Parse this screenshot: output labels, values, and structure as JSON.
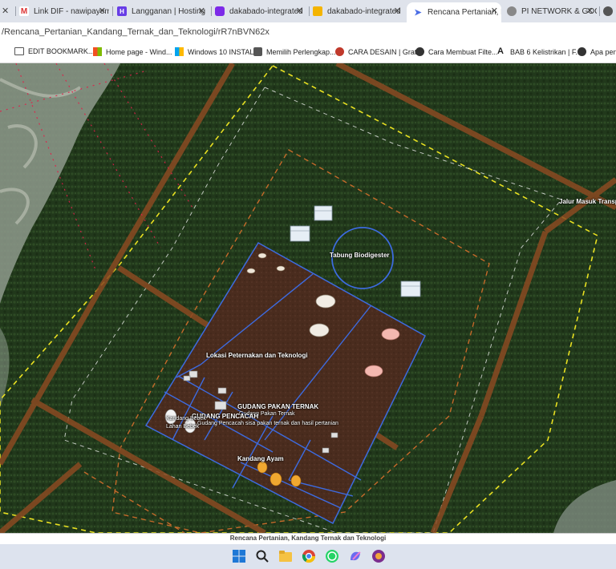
{
  "tabs": [
    {
      "label": "",
      "x": ""
    },
    {
      "label": "Link DIF - nawipayem",
      "x": "✕"
    },
    {
      "label": "Langganan | Hosting",
      "x": "✕"
    },
    {
      "label": "dakabado-integrated",
      "x": "✕"
    },
    {
      "label": "dakabado-integrated",
      "x": "✕"
    },
    {
      "label": "Rencana Pertanian, K",
      "x": "✕"
    },
    {
      "label": "PI NETWORK & GOC",
      "x": "✕"
    }
  ],
  "address": {
    "url": "/Rencana_Pertanian_Kandang_Ternak_dan_Teknologi/rR7nBVN62x"
  },
  "bookmarks": [
    {
      "label": "EDIT BOOKMARK..."
    },
    {
      "label": "Home page - Wind..."
    },
    {
      "label": "Windows 10 INSTALL"
    },
    {
      "label": "Memilih Perlengkap..."
    },
    {
      "label": "CARA DESAIN | Gratis"
    },
    {
      "label": "Cara Membuat Filte..."
    },
    {
      "label": "BAB 6 Kelistrikan | F..."
    },
    {
      "label": "Apa peny"
    }
  ],
  "map_labels": {
    "tabung": "Tabung Biodigester",
    "jalur": "Jalur Masuk Transp",
    "lokasi": "Lokasi Peternakan dan Teknologi",
    "gudang_pakan": "GUDANG PAKAN TERNAK",
    "gudang_pakan_sub": "Gudang Pakan Ternak",
    "gudang_pencacah": "GUDANG PENCACAH",
    "gudang_pencacah_sub": "Gudang Pencacah sisa pakan ternak dan hasil pertanian",
    "kandang_bebek": "Kandang Bebek",
    "lahan_bebek": "Lahan Bebek",
    "kandang_ayam": "Kandang Ayam"
  },
  "caption": "Rencana Pertanian, Kandang Ternak dan Teknologi"
}
